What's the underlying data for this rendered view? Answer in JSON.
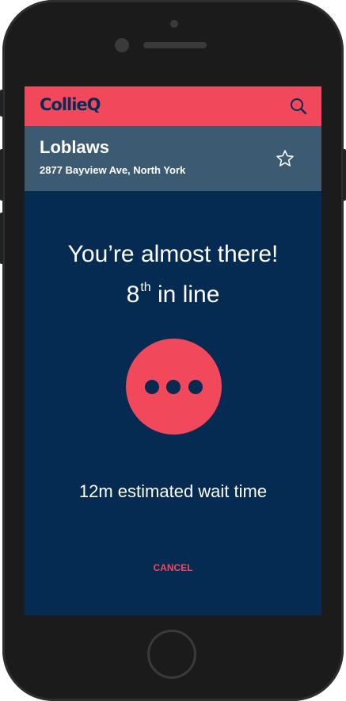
{
  "app": {
    "logo": "CollieQ"
  },
  "header": {
    "search_icon": "search-icon"
  },
  "store": {
    "name": "Loblaws",
    "address": "2877 Bayview Ave, North York",
    "favorite_icon": "star-outline-icon"
  },
  "status": {
    "headline": "You’re almost there!",
    "position_number": "8",
    "position_suffix": "th",
    "position_tail": " in line",
    "wait_time": "12m estimated wait time",
    "indicator_icon": "more-dots-icon"
  },
  "actions": {
    "cancel_label": "CANCEL"
  },
  "colors": {
    "brand_red": "#f1495b",
    "navy": "#062b52",
    "store_bar": "#3d5a73"
  }
}
